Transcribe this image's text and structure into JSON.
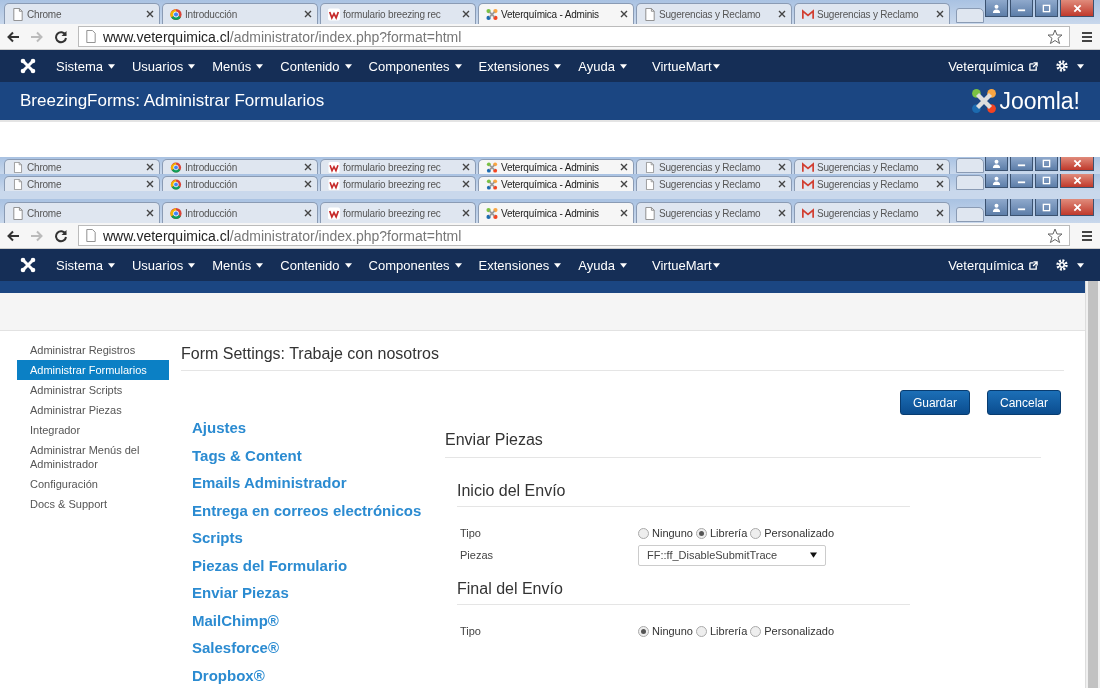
{
  "top_window": {
    "tabs": [
      {
        "label": "Chrome",
        "kind": "page",
        "selected": false
      },
      {
        "label": "Introducción",
        "kind": "chrome",
        "selected": false
      },
      {
        "label": "formulario breezing rec",
        "kind": "w",
        "selected": false
      },
      {
        "label": "Veterquímica - Adminis",
        "kind": "joomla",
        "selected": true
      },
      {
        "label": "Sugerencias y Reclamo",
        "kind": "page",
        "selected": false
      },
      {
        "label": "Sugerencias y Reclamo",
        "kind": "mail",
        "selected": false
      }
    ],
    "address": {
      "host": "www.veterquimica.cl",
      "path": "/administrator/index.php?format=html"
    },
    "nav": {
      "menus": [
        "Sistema",
        "Usuarios",
        "Menús",
        "Contenido",
        "Componentes",
        "Extensiones",
        "Ayuda",
        "VirtueMart"
      ],
      "site_link": "Veterquímica"
    },
    "header": {
      "title": "BreezingForms: Administrar Formularios",
      "logo": "Joomla!"
    }
  },
  "ghost_tab_strips": [
    {
      "tabs": [
        {
          "label": "Chrome",
          "kind": "page",
          "selected": false
        },
        {
          "label": "Introducción",
          "kind": "chrome",
          "selected": false
        },
        {
          "label": "formulario breezing rec",
          "kind": "w",
          "selected": false
        },
        {
          "label": "Veterquímica - Adminis",
          "kind": "joomla",
          "selected": true
        },
        {
          "label": "Sugerencias y Reclamo",
          "kind": "page",
          "selected": false
        },
        {
          "label": "Sugerencias y Reclamo",
          "kind": "mail",
          "selected": false
        }
      ]
    },
    {
      "tabs": [
        {
          "label": "Chrome",
          "kind": "page",
          "selected": false
        },
        {
          "label": "Introducción",
          "kind": "chrome",
          "selected": false
        },
        {
          "label": "formulario breezing rec",
          "kind": "w",
          "selected": false
        },
        {
          "label": "Veterquímica - Adminis",
          "kind": "joomla",
          "selected": true
        },
        {
          "label": "Sugerencias y Reclamo",
          "kind": "page",
          "selected": false
        },
        {
          "label": "Sugerencias y Reclamo",
          "kind": "mail",
          "selected": false
        }
      ]
    }
  ],
  "main_window": {
    "tabs": [
      {
        "label": "Chrome",
        "kind": "page",
        "selected": false
      },
      {
        "label": "Introducción",
        "kind": "chrome",
        "selected": false
      },
      {
        "label": "formulario breezing rec",
        "kind": "w",
        "selected": false
      },
      {
        "label": "Veterquímica - Adminis",
        "kind": "joomla",
        "selected": true
      },
      {
        "label": "Sugerencias y Reclamo",
        "kind": "page",
        "selected": false
      },
      {
        "label": "Sugerencias y Reclamo",
        "kind": "mail",
        "selected": false
      }
    ],
    "address": {
      "host": "www.veterquimica.cl",
      "path": "/administrator/index.php?format=html"
    },
    "nav": {
      "menus": [
        "Sistema",
        "Usuarios",
        "Menús",
        "Contenido",
        "Componentes",
        "Extensiones",
        "Ayuda",
        "VirtueMart"
      ],
      "site_link": "Veterquímica"
    }
  },
  "sidebar": {
    "items": [
      {
        "label": "Administrar Registros",
        "selected": false
      },
      {
        "label": "Administrar Formularios",
        "selected": true
      },
      {
        "label": "Administrar Scripts",
        "selected": false
      },
      {
        "label": "Administrar Piezas",
        "selected": false
      },
      {
        "label": "Integrador",
        "selected": false
      },
      {
        "label": "Administrar Menús del Administrador",
        "selected": false
      },
      {
        "label": "Configuración",
        "selected": false
      },
      {
        "label": "Docs & Support",
        "selected": false
      }
    ]
  },
  "form_settings": {
    "title": "Form Settings: Trabaje con nosotros",
    "buttons": [
      "Guardar",
      "Cancelar"
    ],
    "sections": [
      "Ajustes",
      "Tags & Content",
      "Emails Administrador",
      "Entrega en correos electrónicos",
      "Scripts",
      "Piezas del Formulario",
      "Enviar Piezas",
      "MailChimp®",
      "Salesforce®",
      "Dropbox®"
    ],
    "panel": {
      "title": "Enviar Piezas",
      "groups": [
        {
          "title": "Inicio del Envío",
          "fields": [
            {
              "kind": "radio",
              "label": "Tipo",
              "options": [
                {
                  "label": "Ninguno",
                  "selected": false
                },
                {
                  "label": "Librería",
                  "selected": true
                },
                {
                  "label": "Personalizado",
                  "selected": false
                }
              ]
            },
            {
              "kind": "select",
              "label": "Piezas",
              "value": "FF::ff_DisableSubmitTrace"
            }
          ]
        },
        {
          "title": "Final del Envío",
          "fields": [
            {
              "kind": "radio",
              "label": "Tipo",
              "options": [
                {
                  "label": "Ninguno",
                  "selected": true
                },
                {
                  "label": "Librería",
                  "selected": false
                },
                {
                  "label": "Personalizado",
                  "selected": false
                }
              ]
            }
          ]
        }
      ]
    }
  }
}
